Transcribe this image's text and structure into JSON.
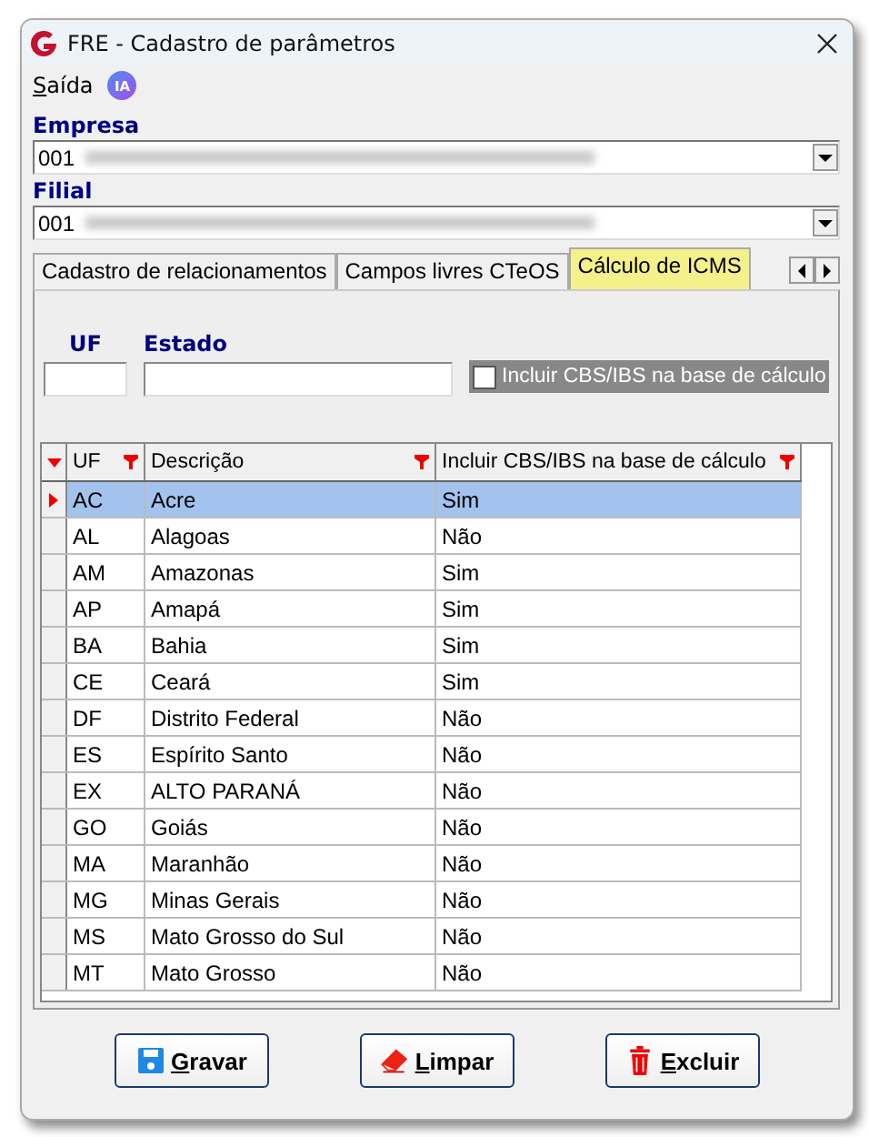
{
  "window": {
    "title": "FRE - Cadastro de parâmetros"
  },
  "menu": [
    {
      "label": "Saída"
    }
  ],
  "ia_badge": "IA",
  "empresa": {
    "label": "Empresa",
    "value": "001"
  },
  "filial": {
    "label": "Filial",
    "value": "001"
  },
  "tabs": [
    {
      "label": "Cadastro de relacionamentos",
      "selected": false
    },
    {
      "label": "Campos livres CTeOS",
      "selected": false
    },
    {
      "label": "Cálculo de ICMS",
      "selected": true
    }
  ],
  "filters": {
    "uf_label": "UF",
    "estado_label": "Estado",
    "checkbox": {
      "label": "Incluir CBS/IBS na base de cálculo",
      "checked": false
    }
  },
  "table": {
    "columns": [
      "UF",
      "Descrição",
      "Incluir CBS/IBS na base de cálculo"
    ],
    "rows": [
      {
        "cells": [
          "AC",
          "Acre",
          "Sim"
        ],
        "selected": true
      },
      {
        "cells": [
          "AL",
          "Alagoas",
          "Não"
        ],
        "selected": false
      },
      {
        "cells": [
          "AM",
          "Amazonas",
          "Sim"
        ],
        "selected": false
      },
      {
        "cells": [
          "AP",
          "Amapá",
          "Sim"
        ],
        "selected": false
      },
      {
        "cells": [
          "BA",
          "Bahia",
          "Sim"
        ],
        "selected": false
      },
      {
        "cells": [
          "CE",
          "Ceará",
          "Sim"
        ],
        "selected": false
      },
      {
        "cells": [
          "DF",
          "Distrito Federal",
          "Não"
        ],
        "selected": false
      },
      {
        "cells": [
          "ES",
          "Espírito Santo",
          "Não"
        ],
        "selected": false
      },
      {
        "cells": [
          "EX",
          "ALTO PARANÁ",
          "Não"
        ],
        "selected": false
      },
      {
        "cells": [
          "GO",
          "Goiás",
          "Não"
        ],
        "selected": false
      },
      {
        "cells": [
          "MA",
          "Maranhão",
          "Não"
        ],
        "selected": false
      },
      {
        "cells": [
          "MG",
          "Minas Gerais",
          "Não"
        ],
        "selected": false
      },
      {
        "cells": [
          "MS",
          "Mato Grosso do Sul",
          "Não"
        ],
        "selected": false
      },
      {
        "cells": [
          "MT",
          "Mato Grosso",
          "Não"
        ],
        "selected": false
      }
    ]
  },
  "buttons": [
    {
      "label": "Gravar",
      "kind": "save"
    },
    {
      "label": "Limpar",
      "kind": "clear"
    },
    {
      "label": "Excluir",
      "kind": "delete"
    }
  ]
}
